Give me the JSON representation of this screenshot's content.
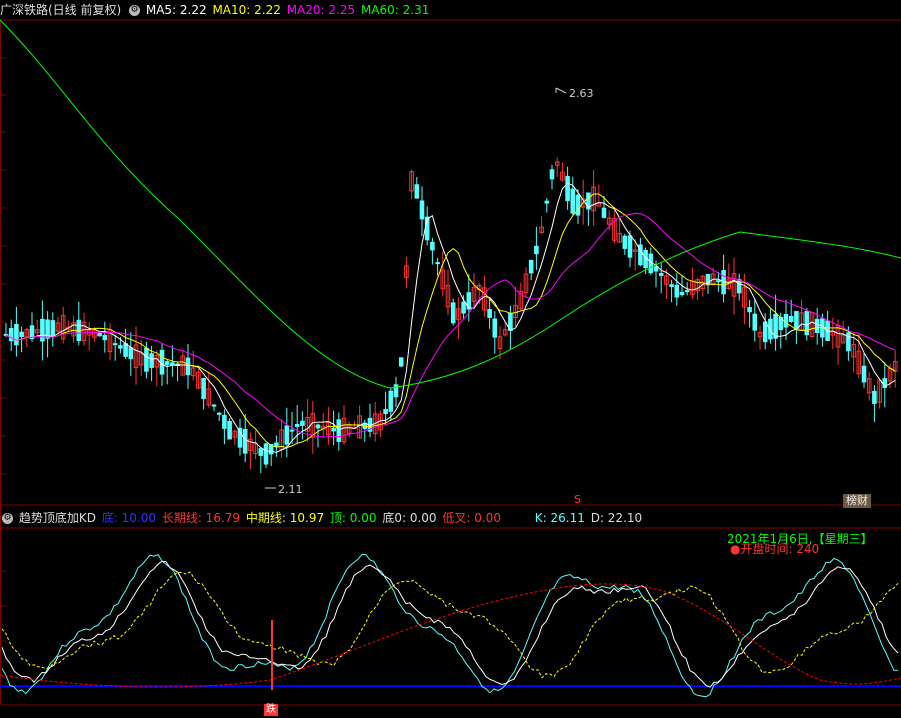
{
  "main_legend": {
    "title": "广深铁路(日线 前复权)",
    "ma5": "MA5: 2.22",
    "ma10": "MA10: 2.22",
    "ma20": "MA20: 2.25",
    "ma60": "MA60: 2.31"
  },
  "price_labels": {
    "high": "2.63",
    "low": "2.11"
  },
  "badge_label": "榜财",
  "marker_s": "S",
  "indicator_legend": {
    "name": "趋势顶底加KD",
    "di": "底: 10.00",
    "long_line": "长期线: 16.79",
    "mid_line": "中期线: 10.97",
    "top": "顶: 0.00",
    "di0": "底0: 0.00",
    "low_cross": "低叉: 0.00",
    "k": "K: 26.11",
    "d": "D: 22.10"
  },
  "info_box": {
    "date": "2021年1月6日,【星期三】",
    "open_time": "●开盘时间:  240"
  },
  "bottom_marker": "跌",
  "colors": {
    "bg": "#000000",
    "up": "#ff3232",
    "down": "#54ffff",
    "ma5": "#ffffff",
    "ma10": "#ffff00",
    "ma20": "#ff00ff",
    "ma60": "#00ff00",
    "grid": "#800000",
    "k_line": "#54ffff",
    "d_line": "#ffffff",
    "mid_line": "#ffff00",
    "long_line": "#ff0000",
    "base_line": "#0000ff"
  }
}
